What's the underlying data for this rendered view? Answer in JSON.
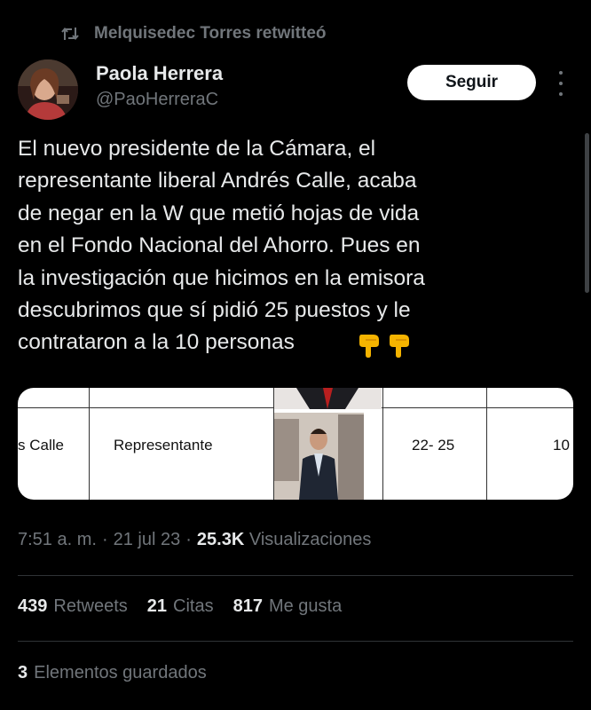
{
  "retweet": {
    "icon": "retweet-icon",
    "label": "Melquisedec Torres retwitteó"
  },
  "author": {
    "name": "Paola Herrera",
    "handle": "@PaoHerreraC",
    "avatar": "avatar-photo"
  },
  "follow_label": "Seguir",
  "tweet": {
    "text": "El nuevo presidente de la Cámara, el\nrepresentante liberal Andrés Calle, acaba\nde negar en la W que metió hojas de vida\nen el Fondo Nacional del Ahorro. Pues en\nla investigación que hicimos en la emisora\ndescubrimos que sí pidió 25 puestos y le\ncontrataron a la 10 personas",
    "emoji": "👇👇"
  },
  "media": {
    "col_name": "s Calle",
    "col_role": "Representante",
    "col_range": "22- 25",
    "col_count": "10"
  },
  "meta": {
    "time": "7:51 a. m.",
    "sep1": "·",
    "date": "21 jul 23",
    "sep2": "·",
    "views_count": "25.3K",
    "views_label": "Visualizaciones"
  },
  "stats": {
    "retweets_count": "439",
    "retweets_label": "Retweets",
    "quotes_count": "21",
    "quotes_label": "Citas",
    "likes_count": "817",
    "likes_label": "Me gusta"
  },
  "saved": {
    "count": "3",
    "label": "Elementos guardados"
  },
  "colors": {
    "background": "#000000",
    "text": "#e7e9ea",
    "secondary": "#71767b",
    "divider": "#2f3336"
  }
}
